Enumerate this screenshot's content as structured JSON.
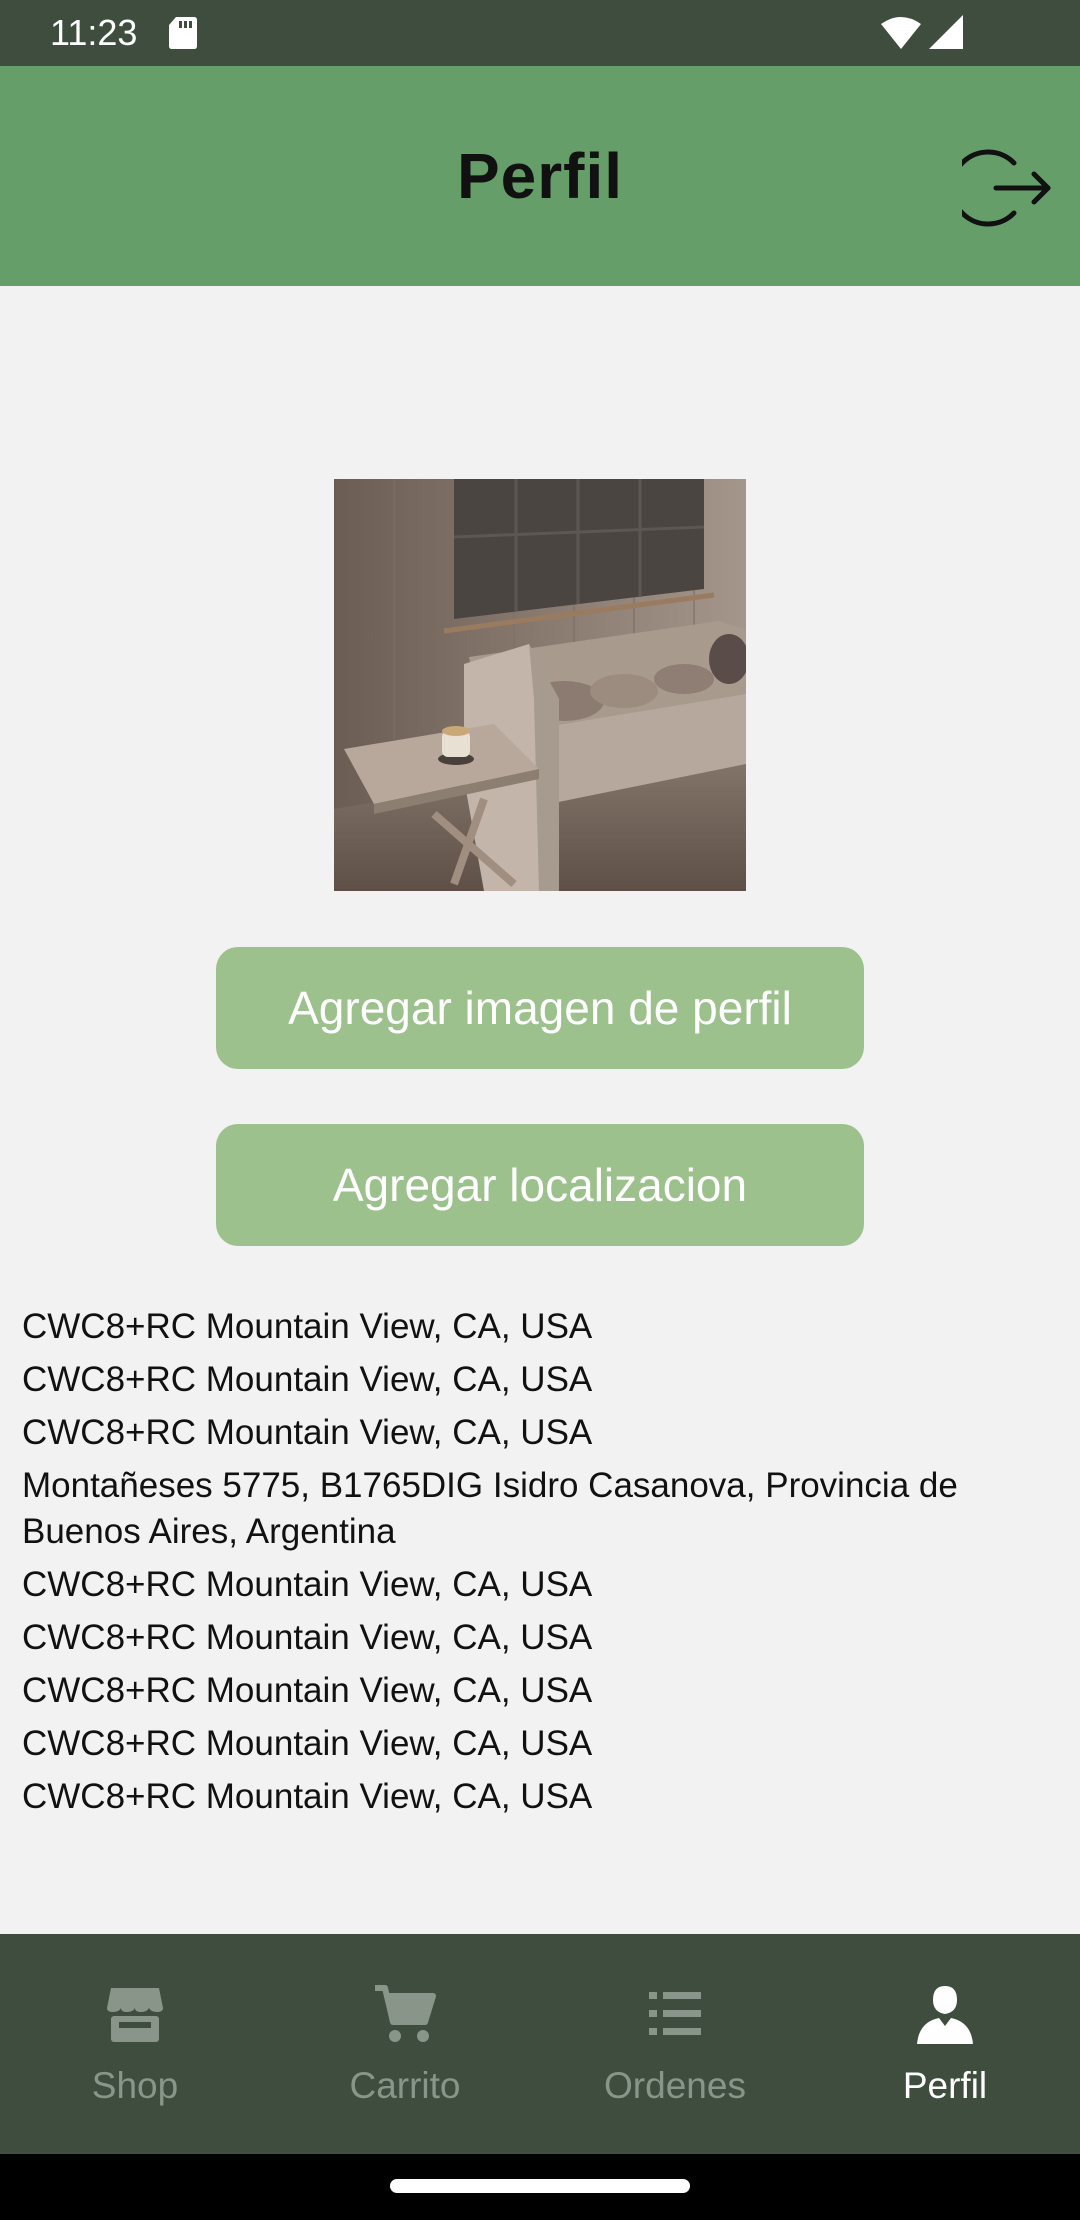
{
  "status_bar": {
    "time": "11:23",
    "icons": [
      "sd-card-icon",
      "wifi-icon",
      "signal-icon"
    ]
  },
  "header": {
    "title": "Perfil",
    "action_icon": "logout-icon"
  },
  "profile": {
    "image_icon": "living-room-sofa-photo",
    "add_image_label": "Agregar imagen de perfil",
    "add_location_label": "Agregar localizacion"
  },
  "locations": [
    "CWC8+RC Mountain View, CA, USA",
    "CWC8+RC Mountain View, CA, USA",
    "CWC8+RC Mountain View, CA, USA",
    "Montañeses 5775, B1765DIG Isidro Casanova, Provincia de Buenos Aires, Argentina",
    "CWC8+RC Mountain View, CA, USA",
    "CWC8+RC Mountain View, CA, USA",
    "CWC8+RC Mountain View, CA, USA",
    "CWC8+RC Mountain View, CA, USA",
    "CWC8+RC Mountain View, CA, USA"
  ],
  "bottom_nav": {
    "items": [
      {
        "label": "Shop",
        "icon": "storefront-icon",
        "active": false
      },
      {
        "label": "Carrito",
        "icon": "cart-icon",
        "active": false
      },
      {
        "label": "Ordenes",
        "icon": "list-icon",
        "active": false
      },
      {
        "label": "Perfil",
        "icon": "person-icon",
        "active": true
      }
    ]
  },
  "colors": {
    "status_bar": "#3f4d3e",
    "app_bar": "#659e68",
    "button": "#9cc18c",
    "background": "#f2f2f2",
    "bottom_nav": "#3f4d3e",
    "nav_inactive": "#8a958a",
    "nav_active": "#ffffff"
  }
}
